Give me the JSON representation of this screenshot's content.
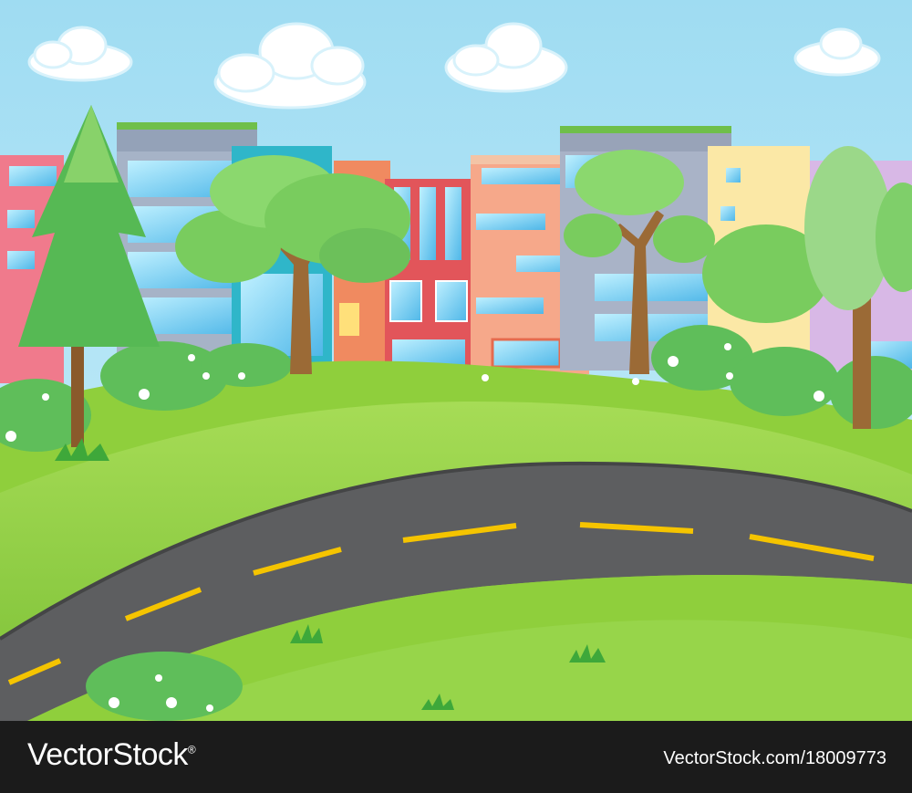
{
  "scene": {
    "sky_color": "#aee3f5",
    "grass_color": "#8fcf3c",
    "road_color": "#5d5e60",
    "lane_marking_color": "#f5c400"
  },
  "watermark": {
    "logo_text": "VectorStock",
    "logo_mark": "®",
    "url_text": "VectorStock.com/18009773"
  }
}
